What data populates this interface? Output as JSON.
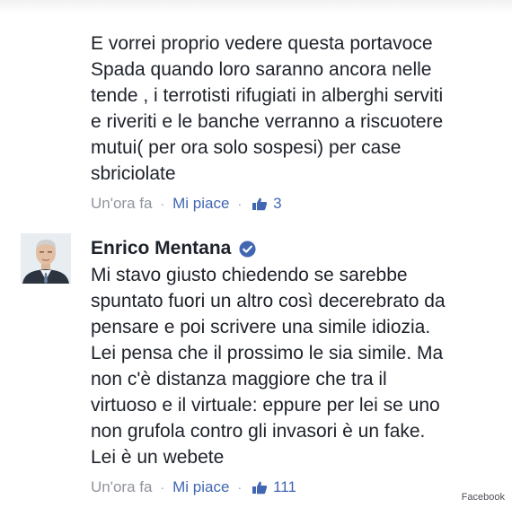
{
  "comments": [
    {
      "text": "E vorrei proprio vedere questa portavoce\nSpada quando loro saranno ancora nelle\ntende , i terrotisti rifugiati in alberghi serviti\ne riveriti e le banche verranno a riscuotere\nmutui( per ora solo sospesi) per case\nsbriciolate",
      "time": "Un'ora fa",
      "like_label": "Mi piace",
      "like_count": "3"
    },
    {
      "author": "Enrico Mentana",
      "verified": true,
      "text": "Mi stavo giusto chiedendo se sarebbe\nspuntato fuori un altro così decerebrato da\npensare e poi scrivere una simile idiozia.\nLei pensa che il prossimo le sia simile. Ma\nnon c'è distanza maggiore che tra il\nvirtuoso e il virtuale: eppure per lei se uno\nnon grufola contro gli invasori è un fake.\nLei è un webete",
      "time": "Un'ora fa",
      "like_label": "Mi piace",
      "like_count": "111"
    }
  ],
  "separator": "·",
  "watermark": "Facebook",
  "colors": {
    "link": "#4267b2",
    "meta": "#90949c",
    "text": "#1d2129"
  },
  "icons": {
    "like": "thumbs-up-icon",
    "verified": "verified-badge-icon"
  }
}
